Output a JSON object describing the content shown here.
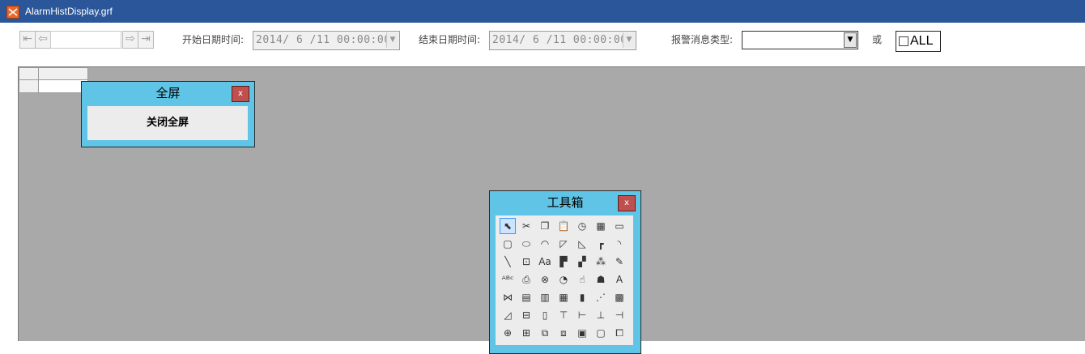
{
  "window": {
    "title": "AlarmHistDisplay.grf"
  },
  "toolbar": {
    "first_icon": "first-page-icon",
    "prev_icon": "prev-page-icon",
    "next_icon": "next-page-icon",
    "last_icon": "last-page-icon",
    "page_value": "",
    "start_label": "开始日期时间:",
    "start_value": "2014/ 6 /11  00:00:00",
    "end_label": "结束日期时间:",
    "end_value": "2014/ 6 /11  00:00:00",
    "type_label": "报警消息类型:",
    "type_value": "",
    "or_label": "或",
    "all_label": "ALL",
    "all_checked": false
  },
  "fullscreen_window": {
    "title": "全屏",
    "close_label": "x",
    "button_label": "关闭全屏"
  },
  "toolbox_window": {
    "title": "工具箱",
    "close_label": "x",
    "tools": [
      [
        "select-tool",
        "cut-tool",
        "copy-tool",
        "paste-tool",
        "clock-tool",
        "calendar-tool",
        "rectangle-tool"
      ],
      [
        "rounded-rect-tool",
        "ellipse-tool",
        "chord-tool",
        "polygon-tool",
        "pie-tool",
        "elbow-tool",
        "arc-tool"
      ],
      [
        "line-tool",
        "text-box-tool",
        "font-tool",
        "button-tool",
        "component-tool",
        "palette-tool",
        "magic-wand-tool"
      ],
      [
        "abc-text-tool",
        "variable-tool",
        "formula-tool",
        "timer-tool",
        "touch-tool",
        "alarm-tool",
        "font-style-tool"
      ],
      [
        "trend-tool",
        "report-x-tool",
        "report-list-tool",
        "report-s-tool",
        "bar-chart-tool",
        "scatter-tool",
        "grid-chart-tool"
      ],
      [
        "angle-grid-tool",
        "align-center-tool",
        "distribute-h-tool",
        "align-top-tool",
        "align-left-tool",
        "align-bottom-tool",
        "align-right-tool"
      ],
      [
        "center-v-tool",
        "center-h-tool",
        "group-tool",
        "ungroup-tool",
        "bring-front-tool",
        "send-back-tool",
        "layer-tool"
      ]
    ],
    "glyphs": [
      [
        "⬉",
        "✂",
        "❐",
        "📋",
        "◷",
        "▦",
        "▭"
      ],
      [
        "▢",
        "⬭",
        "◠",
        "◸",
        "◺",
        "┏",
        "◝"
      ],
      [
        "╲",
        "⊡",
        "Aa",
        "▛",
        "▞",
        "⁂",
        "✎"
      ],
      [
        "ᴬᴮᶜ",
        "⎙",
        "⊗",
        "◔",
        "☝",
        "☗",
        "A"
      ],
      [
        "⋈",
        "▤",
        "▥",
        "▦",
        "▮",
        "⋰",
        "▩"
      ],
      [
        "◿",
        "⊟",
        "▯",
        "⊤",
        "⊢",
        "⊥",
        "⊣"
      ],
      [
        "⊕",
        "⊞",
        "⧉",
        "⧈",
        "▣",
        "▢",
        "⧠"
      ]
    ]
  }
}
